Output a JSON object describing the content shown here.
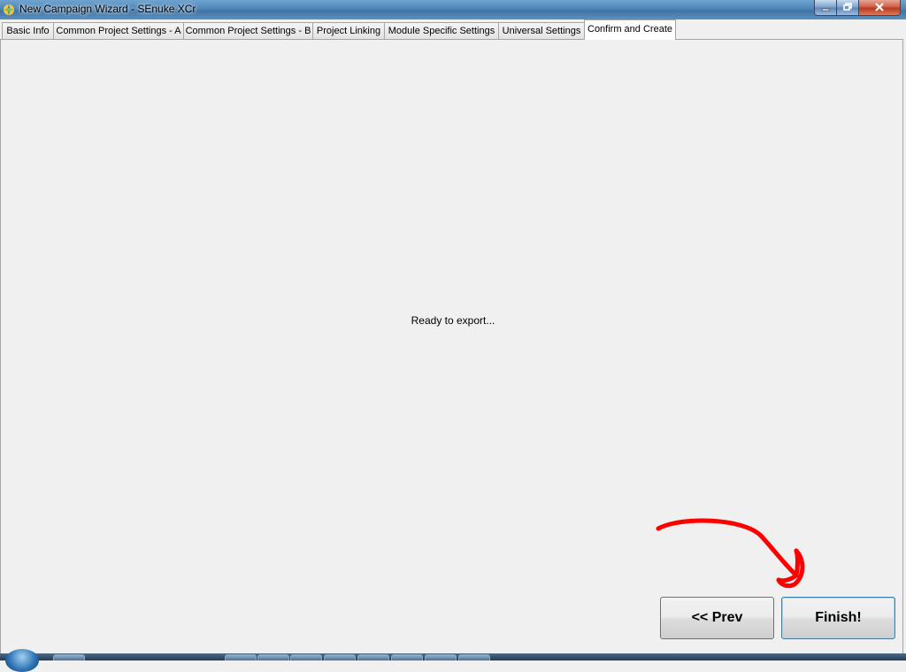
{
  "window": {
    "title": "New Campaign Wizard - SEnuke XCr"
  },
  "tabs": [
    {
      "label": "Basic Info"
    },
    {
      "label": "Common Project Settings - A"
    },
    {
      "label": "Common Project Settings - B"
    },
    {
      "label": "Project Linking"
    },
    {
      "label": "Module Specific Settings"
    },
    {
      "label": "Universal Settings"
    },
    {
      "label": "Confirm and Create"
    }
  ],
  "active_tab": "Confirm and Create",
  "main": {
    "status": "Ready to export..."
  },
  "buttons": {
    "prev": "<< Prev",
    "finish": "Finish!"
  },
  "colors": {
    "annotation": "#ff0000",
    "titlebar": "#4f86b7",
    "background": "#f0f0f0"
  },
  "icons": [
    "app-icon",
    "minimize-icon",
    "maximize-icon",
    "close-icon",
    "start-orb-icon"
  ]
}
